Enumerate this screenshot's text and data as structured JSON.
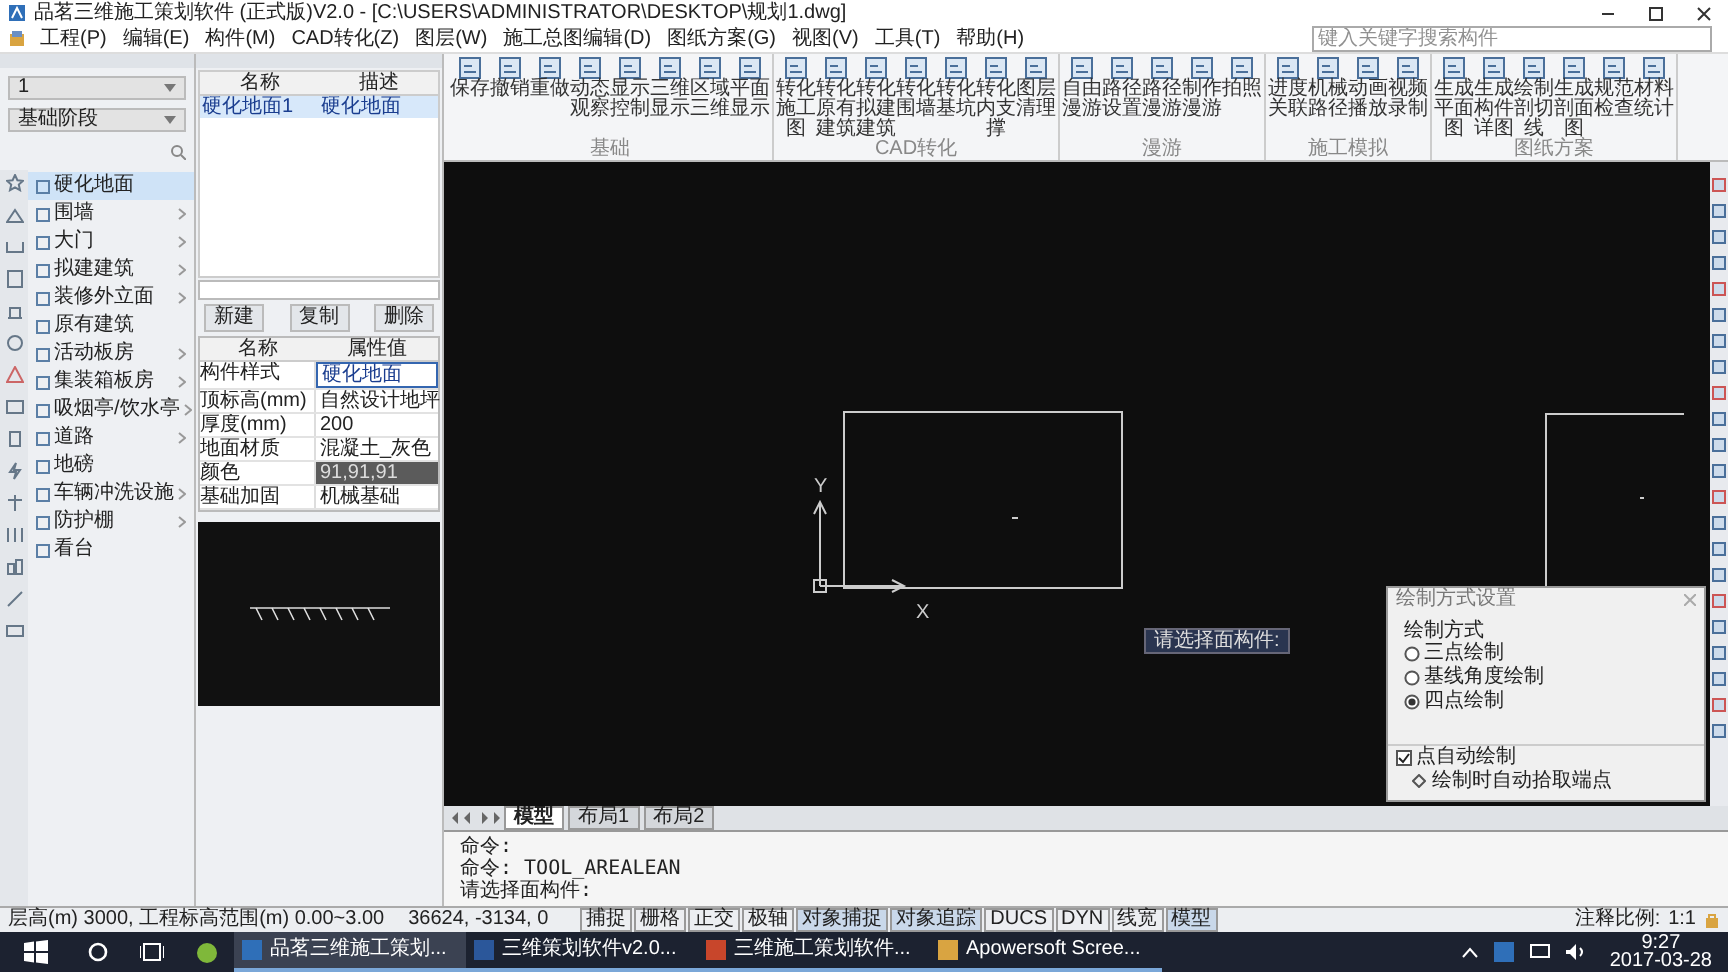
{
  "window": {
    "title": "品茗三维施工策划软件 (正式版)V2.0 - [C:\\USERS\\ADMINISTRATOR\\DESKTOP\\规划1.dwg]"
  },
  "menu": [
    "工程(P)",
    "编辑(E)",
    "构件(M)",
    "CAD转化(Z)",
    "图层(W)",
    "施工总图编辑(D)",
    "图纸方案(G)",
    "视图(V)",
    "工具(T)",
    "帮助(H)"
  ],
  "search": {
    "placeholder": "键入关键字搜索构件"
  },
  "toolbar_groups": [
    {
      "label": "基础",
      "buttons": [
        "保存",
        "撤销",
        "重做",
        "动态观察",
        "显示控制",
        "三维显示",
        "区域三维",
        "平面显示"
      ]
    },
    {
      "label": "CAD转化",
      "buttons": [
        "转化施工图",
        "转化原有建筑",
        "转化拟建建筑",
        "转化围墙",
        "转化基坑",
        "转化内支撑",
        "图层清理"
      ]
    },
    {
      "label": "漫游",
      "buttons": [
        "自由漫游",
        "路径设置",
        "路径漫游",
        "制作漫游",
        "拍照"
      ]
    },
    {
      "label": "施工模拟",
      "buttons": [
        "进度关联",
        "机械路径",
        "动画播放",
        "视频录制"
      ]
    },
    {
      "label": "图纸方案",
      "buttons": [
        "生成平面图",
        "生成构件详图",
        "绘制剖切线",
        "生成剖面图",
        "规范检查",
        "材料统计"
      ]
    }
  ],
  "left_panel": {
    "floor": "1",
    "stage": "基础阶段",
    "categories": [
      {
        "label": "硬化地面",
        "selected": true,
        "expandable": false
      },
      {
        "label": "围墙",
        "selected": false,
        "expandable": true
      },
      {
        "label": "大门",
        "selected": false,
        "expandable": true
      },
      {
        "label": "拟建建筑",
        "selected": false,
        "expandable": true
      },
      {
        "label": "装修外立面",
        "selected": false,
        "expandable": true
      },
      {
        "label": "原有建筑",
        "selected": false,
        "expandable": false
      },
      {
        "label": "活动板房",
        "selected": false,
        "expandable": true
      },
      {
        "label": "集装箱板房",
        "selected": false,
        "expandable": true
      },
      {
        "label": "吸烟亭/饮水亭",
        "selected": false,
        "expandable": true
      },
      {
        "label": "道路",
        "selected": false,
        "expandable": true
      },
      {
        "label": "地磅",
        "selected": false,
        "expandable": false
      },
      {
        "label": "车辆冲洗设施",
        "selected": false,
        "expandable": true
      },
      {
        "label": "防护棚",
        "selected": false,
        "expandable": true
      },
      {
        "label": "看台",
        "selected": false,
        "expandable": false
      }
    ]
  },
  "component_list": {
    "columns": [
      "名称",
      "描述"
    ],
    "rows": [
      {
        "cells": [
          "硬化地面1",
          "硬化地面"
        ],
        "selected": true
      }
    ]
  },
  "component_buttons": [
    "新建",
    "复制",
    "删除"
  ],
  "properties": {
    "columns": [
      "名称",
      "属性值"
    ],
    "rows": [
      {
        "name": "构件样式",
        "value": "硬化地面",
        "kind": "editing"
      },
      {
        "name": "顶标高(mm)",
        "value": "自然设计地坪",
        "kind": "text"
      },
      {
        "name": "厚度(mm)",
        "value": "200",
        "kind": "text"
      },
      {
        "name": "地面材质",
        "value": "混凝土_灰色",
        "kind": "text"
      },
      {
        "name": "颜色",
        "value": "91,91,91",
        "kind": "color"
      },
      {
        "name": "基础加固",
        "value": "机械基础",
        "kind": "text"
      }
    ]
  },
  "canvas": {
    "axis_labels": [
      "Y",
      "X"
    ],
    "tooltip": "请选择面构件:"
  },
  "layout_tabs": [
    {
      "label": "模型",
      "selected": true
    },
    {
      "label": "布局1",
      "selected": false
    },
    {
      "label": "布局2",
      "selected": false
    }
  ],
  "command_lines": [
    "命令:",
    "命令:  TOOL_AREALEAN",
    "请选择面构件:"
  ],
  "status_bar": {
    "info": "层高(m) 3000, 工程标高范围(m) 0.00~3.00",
    "coords": "36624, -3134, 0",
    "toggles": [
      {
        "label": "捕捉",
        "on": false
      },
      {
        "label": "栅格",
        "on": false
      },
      {
        "label": "正交",
        "on": false
      },
      {
        "label": "极轴",
        "on": false
      },
      {
        "label": "对象捕捉",
        "on": true
      },
      {
        "label": "对象追踪",
        "on": true
      },
      {
        "label": "DUCS",
        "on": false
      },
      {
        "label": "DYN",
        "on": false
      },
      {
        "label": "线宽",
        "on": false
      },
      {
        "label": "模型",
        "on": true
      }
    ],
    "scale_label": "注释比例:",
    "scale": "1:1"
  },
  "dialog": {
    "title": "绘制方式设置",
    "group": "绘制方式",
    "options": [
      {
        "label": "三点绘制",
        "selected": false
      },
      {
        "label": "基线角度绘制",
        "selected": false
      },
      {
        "label": "四点绘制",
        "selected": true
      }
    ],
    "auto_draw": {
      "label": "点自动绘制",
      "checked": true
    },
    "sub_option": "绘制时自动拾取端点"
  },
  "taskbar": {
    "items": [
      {
        "label": "品茗三维施工策划...",
        "active": true
      },
      {
        "label": "三维策划软件v2.0...",
        "active": false
      },
      {
        "label": "三维施工策划软件...",
        "active": false
      },
      {
        "label": "Apowersoft Scree...",
        "active": false
      }
    ],
    "time": "9:27",
    "date": "2017-03-28"
  }
}
